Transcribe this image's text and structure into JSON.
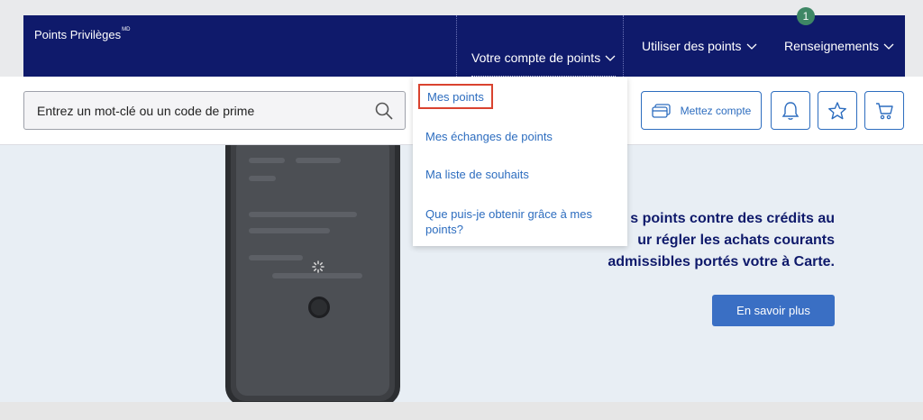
{
  "brand": {
    "name": "Points Privilèges",
    "mark": "MD"
  },
  "nav": {
    "items": [
      {
        "label": "Votre compte de points"
      },
      {
        "label": "Utiliser des points"
      },
      {
        "label": "Renseignements"
      }
    ]
  },
  "search": {
    "placeholder": "Entrez un mot-clé ou un code de prime",
    "icon": "search-icon"
  },
  "toolbar": {
    "account_label": "Mettez compte",
    "notifications_count": "1"
  },
  "dropdown": {
    "items": [
      {
        "label": "Mes points"
      },
      {
        "label": "Mes échanges de points"
      },
      {
        "label": "Ma liste de souhaits"
      },
      {
        "label": "Que puis-je obtenir grâce à mes points?"
      }
    ]
  },
  "hero": {
    "line1": "s points contre des crédits au",
    "line2": "ur régler les achats courants",
    "line3": "admissibles portés votre à Carte.",
    "cta": "En savoir plus"
  },
  "colors": {
    "navy": "#0f1a6b",
    "link_blue": "#2d6dbf",
    "button_blue": "#3a6fc4",
    "highlight_red": "#d9432f",
    "badge_green": "#3e8765"
  }
}
